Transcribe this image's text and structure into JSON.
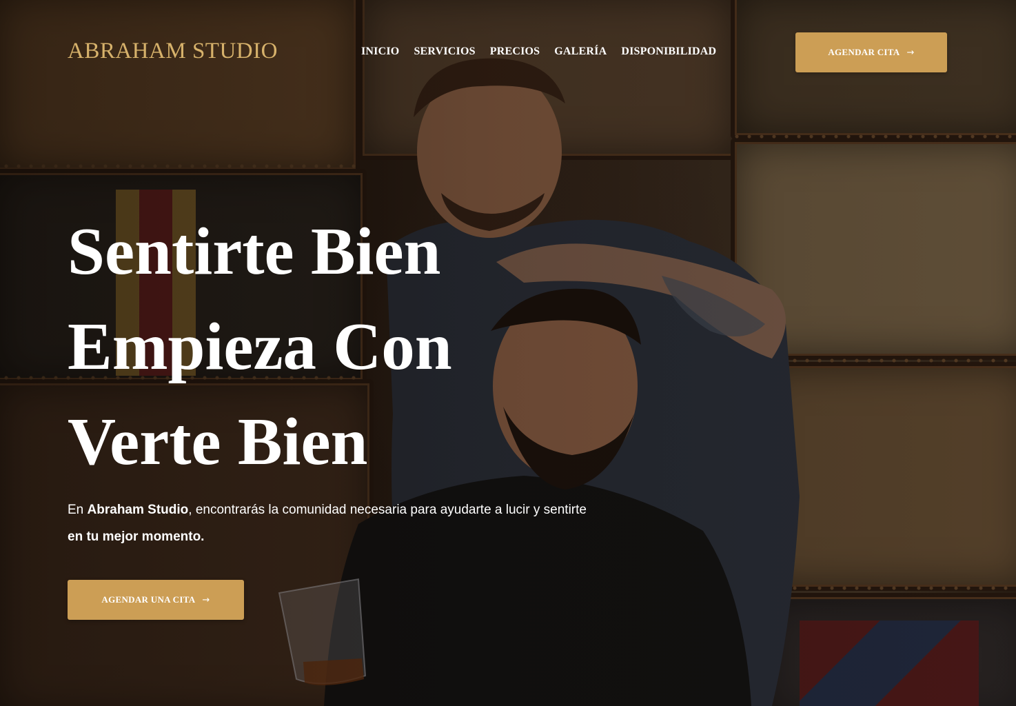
{
  "brand": {
    "name": "ABRAHAM STUDIO",
    "accent_color": "#cc9e55",
    "logo_color": "#d7b26b"
  },
  "nav": {
    "items": [
      "INICIO",
      "SERVICIOS",
      "PRECIOS",
      "GALERÍA",
      "DISPONIBILIDAD"
    ]
  },
  "header_cta": {
    "label": "AGENDAR CITA",
    "icon": "arrow-right-icon"
  },
  "hero": {
    "headline_lines": [
      "Sentirte Bien",
      "Empieza Con",
      "Verte Bien"
    ],
    "intro": {
      "part1": "En ",
      "bold1": "Abraham Studio",
      "part2": ", encontrarás la comunidad necesaria para ayudarte a lucir y sentirte ",
      "bold2": "en tu mejor momento."
    },
    "cta": {
      "label": "AGENDAR UNA CITA",
      "icon": "arrow-right-icon"
    },
    "background": "photo-barber-cutting-hair-vintage-trunks"
  }
}
